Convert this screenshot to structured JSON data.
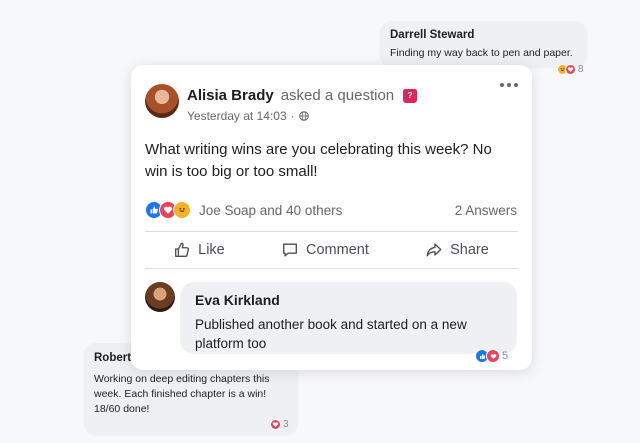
{
  "colors": {
    "like_blue": "#1877f2",
    "love_red": "#f33e58",
    "haha_yellow": "#f7b125",
    "question_badge": "#e0245e",
    "muted_text": "#65676b"
  },
  "background_comments": {
    "darrell": {
      "name": "Darrell Steward",
      "text": "Finding my way back to pen and paper.",
      "reaction_count": "8",
      "reaction_icons": [
        "haha-icon",
        "love-icon"
      ]
    },
    "robert": {
      "name": "Robert",
      "text": "Working on deep editing chapters this week. Each finished chapter is a win! 18/60 done!",
      "reaction_count": "3",
      "reaction_icons": [
        "love-icon"
      ]
    }
  },
  "post": {
    "author": "Alisia Brady",
    "action": "asked a question",
    "badge_icon": "question-icon",
    "timestamp": "Yesterday at 14:03",
    "separator": "·",
    "privacy_icon": "globe-icon",
    "text": "What writing wins are you celebrating this week? No win is too big or too small!",
    "reactions": {
      "icons": [
        "like-icon",
        "love-icon",
        "haha-icon"
      ],
      "summary": "Joe Soap and 40 others"
    },
    "answers": "2 Answers",
    "actions": {
      "like": "Like",
      "comment": "Comment",
      "share": "Share"
    }
  },
  "reply": {
    "name": "Eva Kirkland",
    "text": "Published another book and started on a new platform too",
    "reaction_count": "5",
    "reaction_icons": [
      "like-icon",
      "love-icon"
    ]
  }
}
